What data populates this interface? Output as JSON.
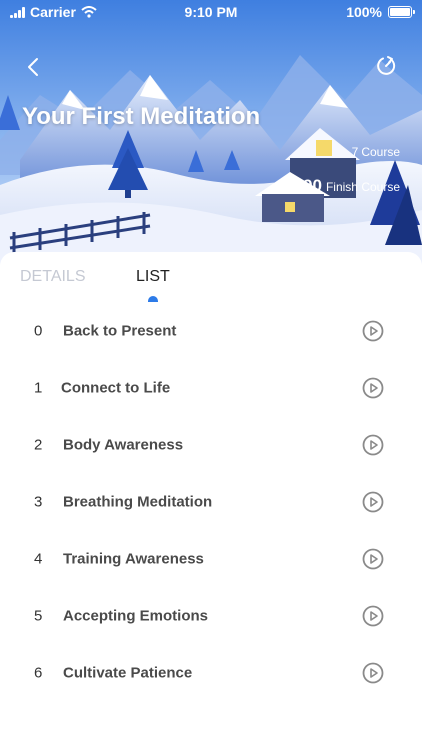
{
  "status_bar": {
    "carrier": "Carrier",
    "time": "9:10 PM",
    "battery": "100%",
    "signal_icon": "signal-bars-icon",
    "wifi_icon": "wifi-icon",
    "battery_icon": "battery-full-icon"
  },
  "header": {
    "title": "Your First Meditation",
    "course_count": "7",
    "course_label": "Course",
    "finish_count": "290",
    "finish_label": "Finish Course",
    "back_icon": "chevron-left-icon",
    "reset_icon": "reset-icon"
  },
  "tabs": [
    {
      "label": "DETAILS",
      "active": false
    },
    {
      "label": "LIST",
      "active": true
    }
  ],
  "lessons": [
    {
      "number": "0",
      "title": "Back to Present"
    },
    {
      "number": "1",
      "title": "Connect to Life"
    },
    {
      "number": "2",
      "title": "Body Awareness"
    },
    {
      "number": "3",
      "title": "Breathing Meditation"
    },
    {
      "number": "4",
      "title": "Training Awareness"
    },
    {
      "number": "5",
      "title": "Accepting Emotions"
    },
    {
      "number": "6",
      "title": "Cultivate Patience"
    }
  ],
  "colors": {
    "accent": "#2d7be8",
    "inactive_tab": "#c5c9d3",
    "lesson_text": "#4a4a4a",
    "play_icon": "#8a8a8a"
  }
}
